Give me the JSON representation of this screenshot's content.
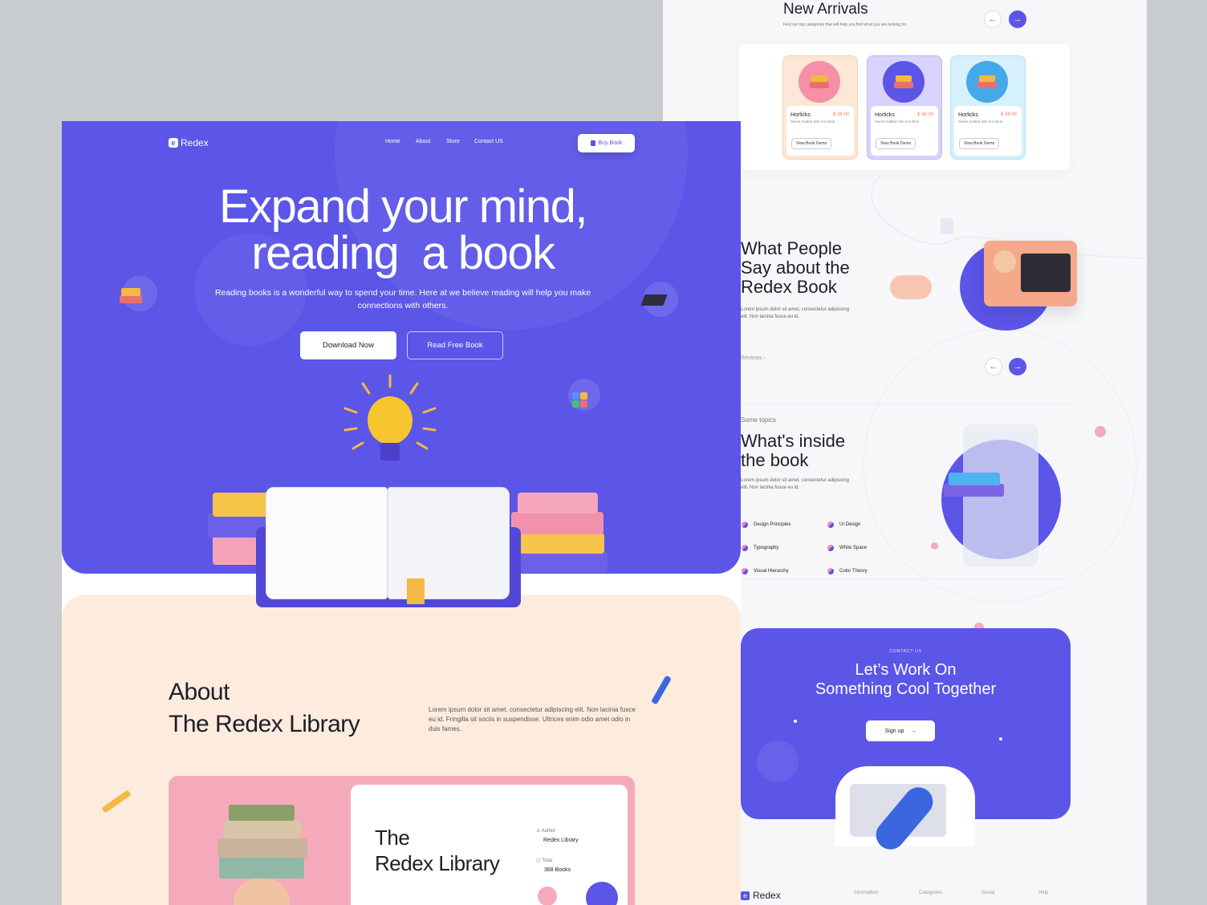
{
  "colors": {
    "brand": "#5b55e8",
    "accent_pink": "#f5aabb",
    "peach": "#fdecde",
    "price": "#f07a52"
  },
  "hero_page": {
    "logo": "Redex",
    "logo_mark": "e",
    "nav": [
      "Home",
      "About",
      "Store",
      "Contact US"
    ],
    "buy_button": "Buy Book",
    "headline_line1": "Expand your mind,",
    "headline_line2": "reading  a book",
    "subline": "Reading books is a wonderful way to spend your time. Here at we believe reading will help you make connections with others.",
    "btn_download": "Download Now",
    "btn_read": "Read Free Book",
    "about_line1": "About",
    "about_line2": "The Redex Library",
    "about_text": "Lorem ipsum dolor sit amet, consectetur adipiscing elit. Non lacinia fusce eu id. Fringilla sit sociis in suspendisse. Ultrices enim odio amet odio in duis fames.",
    "lib_line1": "The",
    "lib_line2": "Redex Library",
    "author_label": "Author",
    "author_value": "Redex Library",
    "total_label": "Total",
    "total_value": "368 Books"
  },
  "arrivals": {
    "title": "New Arrivals",
    "subtitle": "Find our top categories that will help you find what you are looking for.",
    "cards": [
      {
        "name": "Horlicks",
        "price": "$ 34.00",
        "desc": "Sweet malted milk hot drink",
        "button": "View Book Demo",
        "bg": "#fde7d6",
        "circle": "#f590a8"
      },
      {
        "name": "Horlicks",
        "price": "$ 34.00",
        "desc": "Sweet malted milk hot drink",
        "button": "View Book Demo",
        "bg": "#d7d3fa",
        "circle": "#5b55e8"
      },
      {
        "name": "Horlicks",
        "price": "$ 34.00",
        "desc": "Sweet malted milk hot drink",
        "button": "View Book Demo",
        "bg": "#d6f1fb",
        "circle": "#45a8e8"
      }
    ]
  },
  "testimonials": {
    "title_l1": "What People",
    "title_l2": "Say about the",
    "title_l3": "Redex Book",
    "text": "Lorem ipsum dolor sit amet, consectetur adipiscing elit. Non lacinia fusce eu id.",
    "link": "Reviews"
  },
  "topics": {
    "eyebrow": "Some topics",
    "title_l1": "What's inside",
    "title_l2": "the book",
    "text": "Lorem ipsum dolor sit amet, consectetur adipiscing elit. Non lacinia fusce eu id.",
    "items": [
      "Design Principles",
      "UI Design",
      "Typography",
      "White Space",
      "Visual Hierarchy",
      "Color Theory"
    ]
  },
  "contact": {
    "eyebrow": "CONTACT US",
    "title_l1": "Let’s Work On",
    "title_l2": "Something Cool Together",
    "button": "Sign up"
  },
  "footer": {
    "logo": "Redex",
    "logo_mark": "e",
    "links": [
      "Information",
      "Categories",
      "Social",
      "Help"
    ]
  }
}
